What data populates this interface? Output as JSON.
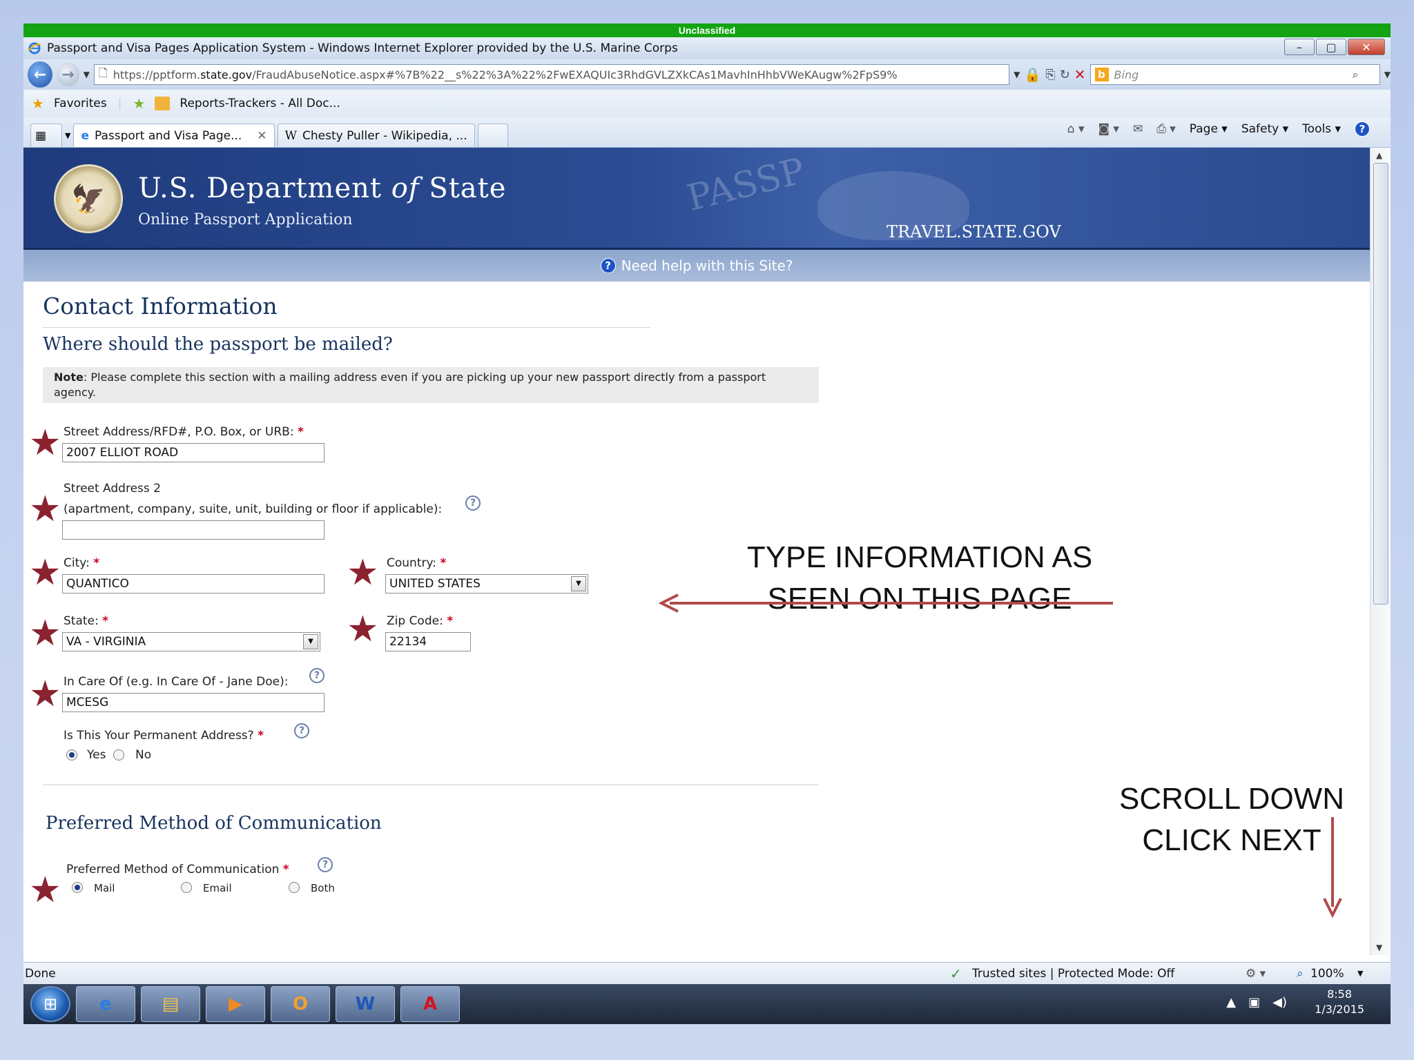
{
  "banner": "Unclassified",
  "window": {
    "title": "Passport and Visa Pages Application System - Windows Internet Explorer provided by the U.S. Marine Corps",
    "min": "–",
    "max": "▢",
    "close": "✕"
  },
  "address": {
    "url_prefix": "https://pptform.",
    "url_domain": "state.gov",
    "url_rest": "/FraudAbuseNotice.aspx#%7B%22__s%22%3A%22%2FwEXAQUIc3RhdGVLZXkCAs1MavhInHhbVWeKAugw%2FpS9%",
    "search_placeholder": "Bing"
  },
  "favorites": {
    "favorites_label": "Favorites",
    "item1": "Reports-Trackers - All Doc..."
  },
  "tabs": [
    {
      "label": "Passport and Visa Page..."
    },
    {
      "label": "Chesty Puller - Wikipedia, ..."
    }
  ],
  "commandbar": {
    "page": "Page ▾",
    "safety": "Safety ▾",
    "tools": "Tools ▾"
  },
  "header": {
    "dept": "U.S. Department",
    "of": "of",
    "state": "State",
    "subtitle": "Online Passport Application",
    "watermark": "PASSP",
    "site": "TRAVEL.STATE.GOV"
  },
  "help_bar": "Need help with this Site?",
  "form": {
    "title": "Contact Information",
    "subtitle": "Where should the passport be mailed?",
    "note_label": "Note",
    "note_text": ": Please complete this section with a mailing address even if you are picking up your new passport directly from a passport agency.",
    "street1_label": "Street Address/RFD#, P.O. Box, or URB: ",
    "street1_value": "2007 ELLIOT ROAD",
    "street2_label": "Street Address 2",
    "street2_hint": "(apartment, company, suite, unit, building or floor if applicable):",
    "street2_value": "",
    "city_label": "City: ",
    "city_value": "QUANTICO",
    "country_label": "Country: ",
    "country_value": "UNITED STATES",
    "state_label": "State: ",
    "state_value": "VA - VIRGINIA",
    "zip_label": "Zip Code: ",
    "zip_value": "22134",
    "care_label": "In Care Of (e.g. In Care Of - Jane Doe):",
    "care_value": "MCESG",
    "permanent_label": "Is This Your Permanent Address? ",
    "yes": "Yes",
    "no": "No",
    "permanent_selected": "Yes",
    "section2_title": "Preferred Method of Communication",
    "comm_label": "Preferred Method of Communication ",
    "comm_mail": "Mail",
    "comm_email": "Email",
    "comm_both": "Both",
    "comm_selected": "Mail",
    "required_mark": "*"
  },
  "annotations": {
    "type_line1": "TYPE INFORMATION AS",
    "type_line2": "SEEN ON THIS PAGE",
    "scroll_line1": "SCROLL DOWN",
    "scroll_line2": "CLICK NEXT",
    "arrow_color": "#b04a4a",
    "star_color": "#8b2230"
  },
  "status": {
    "left": "Done",
    "zone": "Trusted sites | Protected Mode: Off",
    "zoom": "100%"
  },
  "taskbar": {
    "time": "8:58",
    "date": "1/3/2015"
  }
}
